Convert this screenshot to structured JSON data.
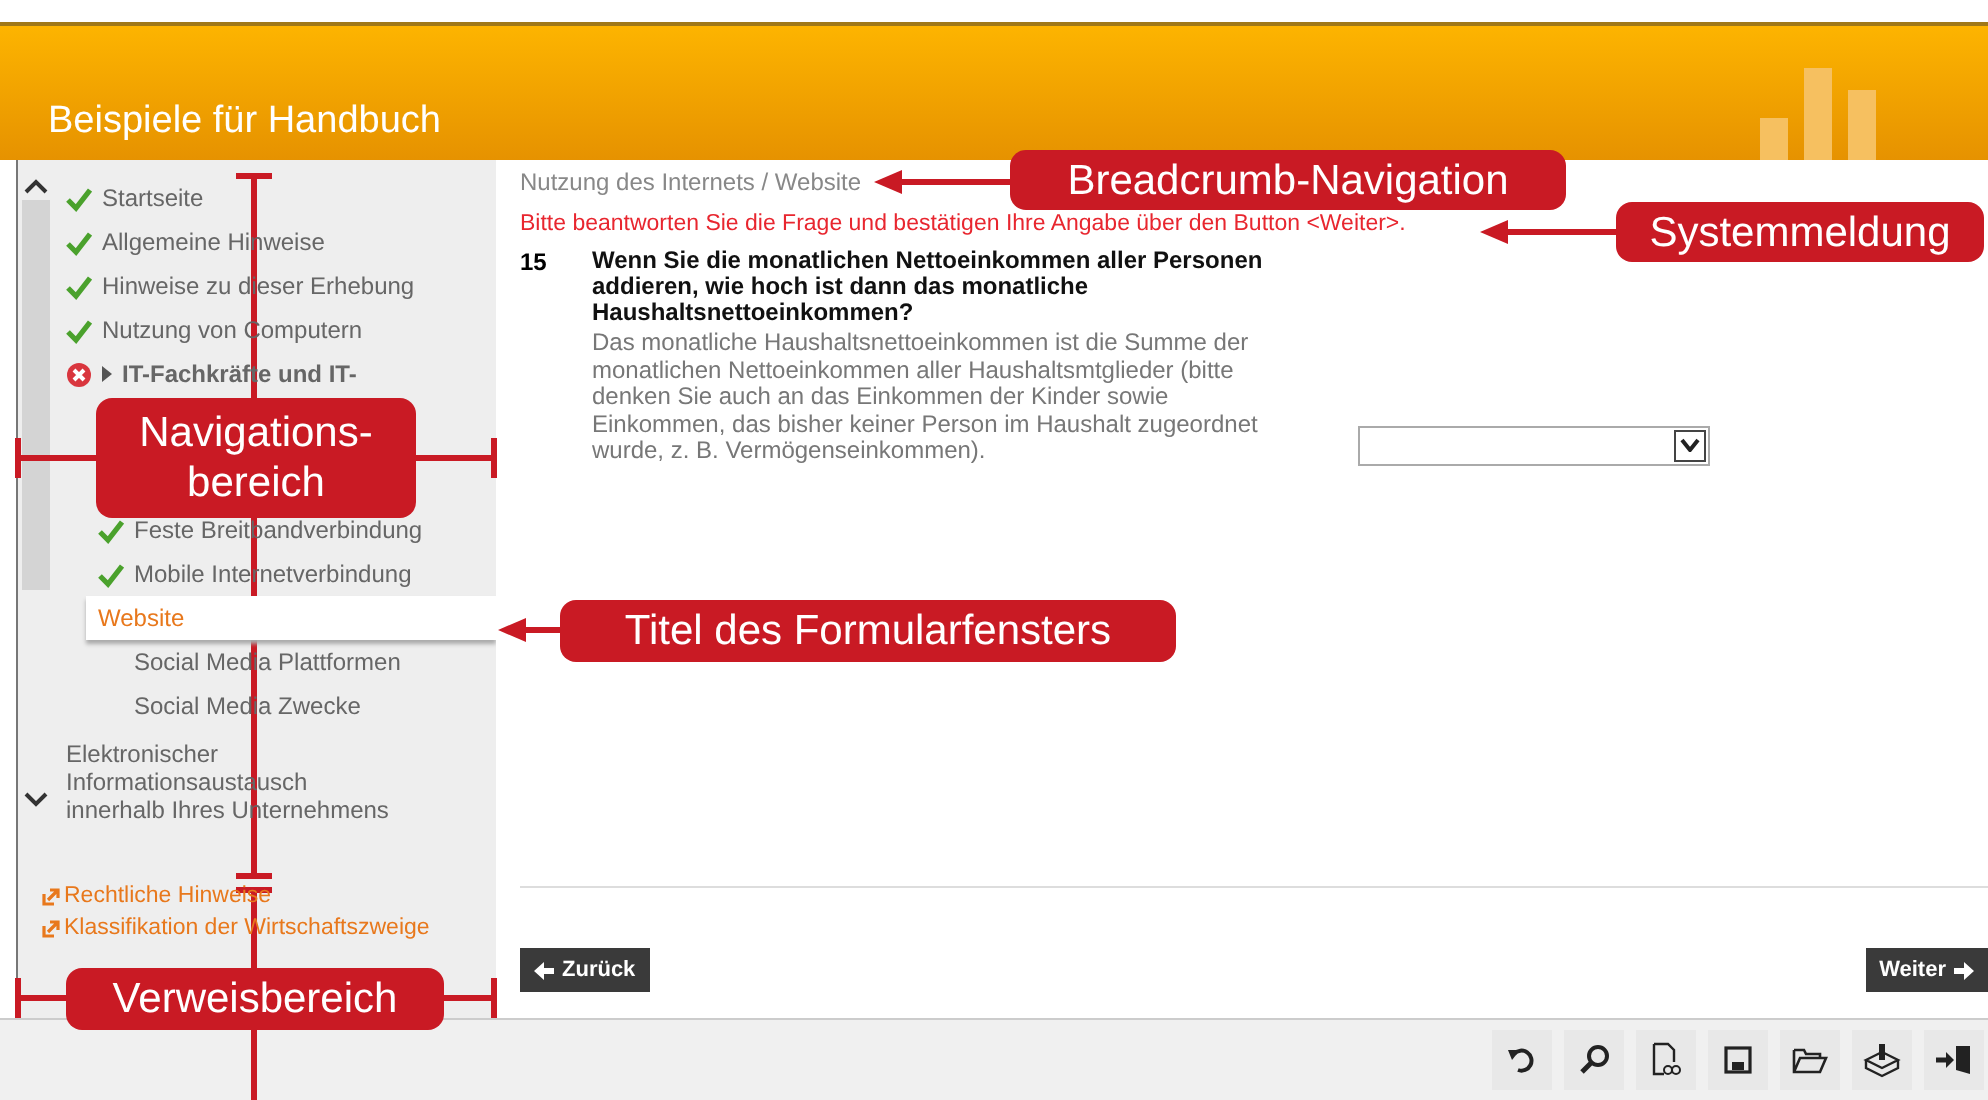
{
  "header": {
    "title": "Beispiele für Handbuch"
  },
  "nav": {
    "items": [
      {
        "label": "Startseite",
        "checked": true,
        "error": false
      },
      {
        "label": "Allgemeine Hinweise",
        "checked": true,
        "error": false
      },
      {
        "label": "Hinweise zu dieser Erhebung",
        "checked": true,
        "error": false
      },
      {
        "label": "Nutzung von Computern",
        "checked": true,
        "error": false
      },
      {
        "label": "IT-Fachkräfte und IT-",
        "checked": false,
        "error": true,
        "expanded": false
      }
    ],
    "sub_items": [
      {
        "label": "Feste Breitbandverbindung",
        "checked": true,
        "selected": false
      },
      {
        "label": "Mobile Internetverbindung",
        "checked": true,
        "selected": false
      },
      {
        "label": "Website",
        "checked": false,
        "selected": true
      },
      {
        "label": "Social Media Plattformen",
        "checked": false,
        "selected": false
      },
      {
        "label": "Social Media Zwecke",
        "checked": false,
        "selected": false
      }
    ],
    "items_after": [
      {
        "label": "Elektronischer Informationsaustausch innerhalb Ihres Unternehmens",
        "checked": false
      }
    ]
  },
  "links": [
    "Rechtliche Hinweise",
    "Klassifikation der Wirtschaftszweige"
  ],
  "breadcrumb": "Nutzung des Internets / Website",
  "message": "Bitte beantworten Sie die Frage und bestätigen Ihre Angabe über den Button <Weiter>.",
  "question": {
    "number": "15",
    "text": "Wenn Sie die monatlichen Nettoeinkommen aller Personen addieren, wie hoch ist dann das monatliche Haushaltsnettoeinkommen?",
    "hint": "Das monatliche Haushaltsnettoeinkommen ist die Summe der monatlichen Nettoeinkommen aller Haushaltsmtglieder (bitte denken Sie auch an das Einkommen der Kinder sowie Einkommen, das bisher keiner Person im Haushalt zugeordnet wurde, z. B. Vermögenseinkommen)."
  },
  "buttons": {
    "back": "Zurück",
    "next": "Weiter"
  },
  "toolbar": [
    {
      "kind": "undo"
    },
    {
      "kind": "search"
    },
    {
      "kind": "check"
    },
    {
      "kind": "save"
    },
    {
      "kind": "open"
    },
    {
      "kind": "send"
    },
    {
      "kind": "exit"
    }
  ],
  "annotations": [
    {
      "kind": "breadcrumb",
      "text": "Breadcrumb-Navigation"
    },
    {
      "kind": "message",
      "text": "Systemmeldung"
    },
    {
      "kind": "nav",
      "text": "Navigations-\nbereich"
    },
    {
      "kind": "title",
      "text": "Titel des Formularfensters"
    },
    {
      "kind": "links",
      "text": "Verweisbereich"
    }
  ]
}
